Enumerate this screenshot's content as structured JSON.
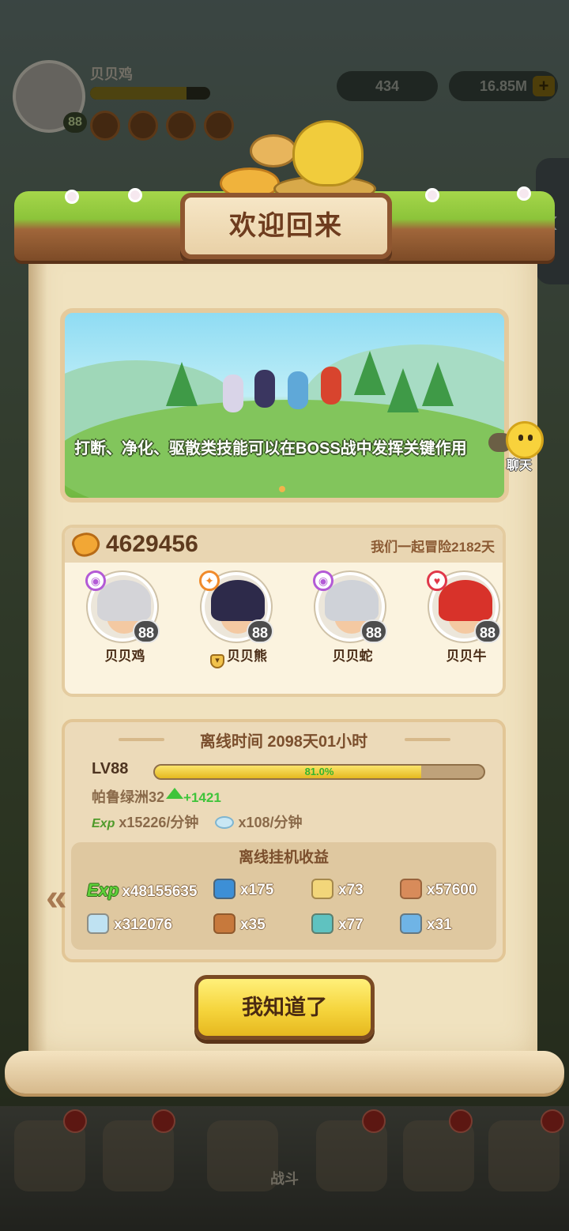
{
  "background": {
    "player_name": "贝贝鸡",
    "player_level": "88",
    "resource_1": "434",
    "resource_2": "16.85M",
    "resource_2_plus": "+",
    "side_tab_arrow": "‹",
    "battle_tab_label": "战斗"
  },
  "dialog": {
    "title": "欢迎回来",
    "tip_text": "打断、净化、驱散类技能可以在BOSS战中发挥关键作用",
    "chat_label": "聊天",
    "gold_amount": "4629456",
    "adventure_text": "我们一起冒险2182天",
    "members": [
      {
        "name": "贝贝鸡",
        "level": "88",
        "element_icon": "wind-element-icon",
        "element_glyph": "◉",
        "element_color": "#b35ad6",
        "hair_color": "#d4d4d8",
        "has_shield": false
      },
      {
        "name": "贝贝熊",
        "level": "88",
        "element_icon": "fire-element-icon",
        "element_glyph": "✦",
        "element_color": "#f08a2a",
        "hair_color": "#2d2a4a",
        "has_shield": true
      },
      {
        "name": "贝贝蛇",
        "level": "88",
        "element_icon": "wind-element-icon",
        "element_glyph": "◉",
        "element_color": "#b35ad6",
        "hair_color": "#cfd2d8",
        "has_shield": false
      },
      {
        "name": "贝贝牛",
        "level": "88",
        "element_icon": "heart-element-icon",
        "element_glyph": "♥",
        "element_color": "#e0384a",
        "hair_color": "#d8322a",
        "has_shield": false
      }
    ],
    "offline": {
      "time_text": "离线时间 2098天01小时",
      "level_label": "LV88",
      "xp_percent_text": "81.0%",
      "xp_progress": 0.81,
      "stage_text": "帕鲁绿洲32",
      "stage_gain": "+1421",
      "exp_label": "Exp",
      "exp_rate": "x15226/分钟",
      "gem_rate": "x108/分钟",
      "rewards_title": "离线挂机收益",
      "rewards": [
        {
          "icon": "exp-icon",
          "label": "Exp",
          "amount": "x48155635"
        },
        {
          "icon": "shirt-icon",
          "amount": "x175",
          "color": "#3d8fd6"
        },
        {
          "icon": "lamp-icon",
          "amount": "x73",
          "color": "#f2d67a"
        },
        {
          "icon": "medal-icon",
          "amount": "x57600",
          "color": "#d88b5a"
        },
        {
          "icon": "gem-icon",
          "amount": "x312076",
          "color": "#bfe2f2"
        },
        {
          "icon": "meat-icon",
          "amount": "x35",
          "color": "#c7793c"
        },
        {
          "icon": "crystal-icon",
          "amount": "x77",
          "color": "#5fc2c0"
        },
        {
          "icon": "ice-shard-icon",
          "amount": "x31",
          "color": "#6fb4e6"
        }
      ],
      "prev_arrow": "«"
    },
    "confirm_button": "我知道了"
  }
}
